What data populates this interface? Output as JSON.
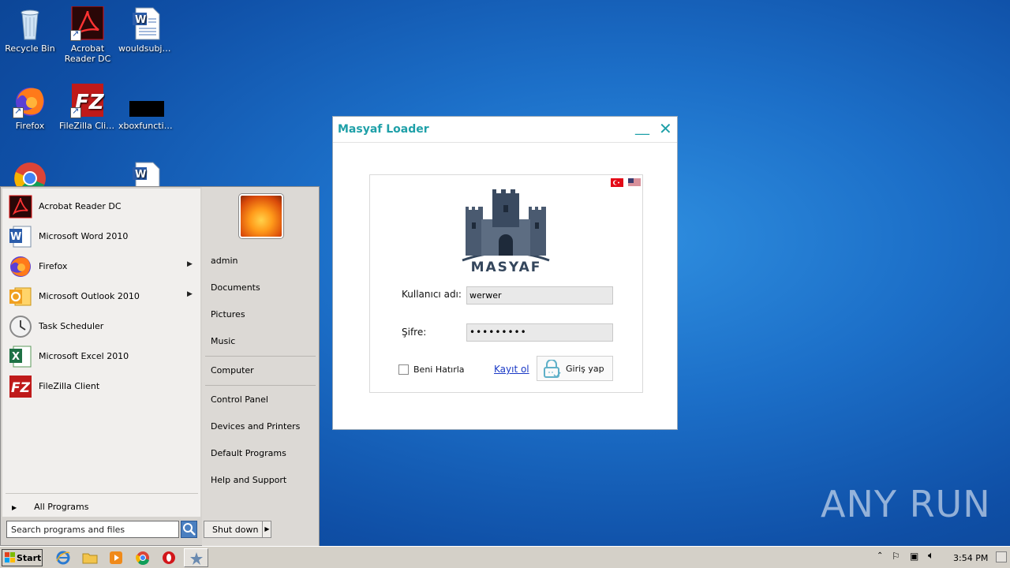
{
  "desktop": {
    "icons": [
      {
        "label": "Recycle Bin"
      },
      {
        "label": "Acrobat Reader DC"
      },
      {
        "label": "wouldsubje..."
      },
      {
        "label": "Firefox"
      },
      {
        "label": "FileZilla Client"
      },
      {
        "label": "xboxfunctio..."
      }
    ]
  },
  "loader": {
    "title": "Masyaf Loader",
    "minimize": "__",
    "close": "✕",
    "logo_text": "MASYAF",
    "username_label": "Kullanıcı adı:",
    "username_value": "werwer",
    "password_label": "Şifre:",
    "password_value": "•••••••••",
    "remember_label": "Beni Hatırla",
    "register_link": "Kayıt ol",
    "login_button": "Giriş yap"
  },
  "start_menu": {
    "programs": [
      {
        "label": "Acrobat Reader DC",
        "icon": "acrobat-icon",
        "submenu": false
      },
      {
        "label": "Microsoft Word 2010",
        "icon": "word-icon",
        "submenu": false
      },
      {
        "label": "Firefox",
        "icon": "firefox-icon",
        "submenu": true
      },
      {
        "label": "Microsoft Outlook 2010",
        "icon": "outlook-icon",
        "submenu": true
      },
      {
        "label": "Task Scheduler",
        "icon": "clock-icon",
        "submenu": false
      },
      {
        "label": "Microsoft Excel 2010",
        "icon": "excel-icon",
        "submenu": false
      },
      {
        "label": "FileZilla Client",
        "icon": "filezilla-icon",
        "submenu": false
      }
    ],
    "all_programs": "All Programs",
    "search_placeholder": "Search programs and files",
    "right_links": [
      "admin",
      "Documents",
      "Pictures",
      "Music",
      "Computer",
      "Control Panel",
      "Devices and Printers",
      "Default Programs",
      "Help and Support"
    ],
    "shutdown": "Shut down"
  },
  "taskbar": {
    "start": "Start",
    "clock": "3:54 PM"
  },
  "watermark": "ANY RUN",
  "colors": {
    "accent": "#1fa0a8",
    "link": "#1a39c6",
    "desktop": "#1c6fc8"
  }
}
